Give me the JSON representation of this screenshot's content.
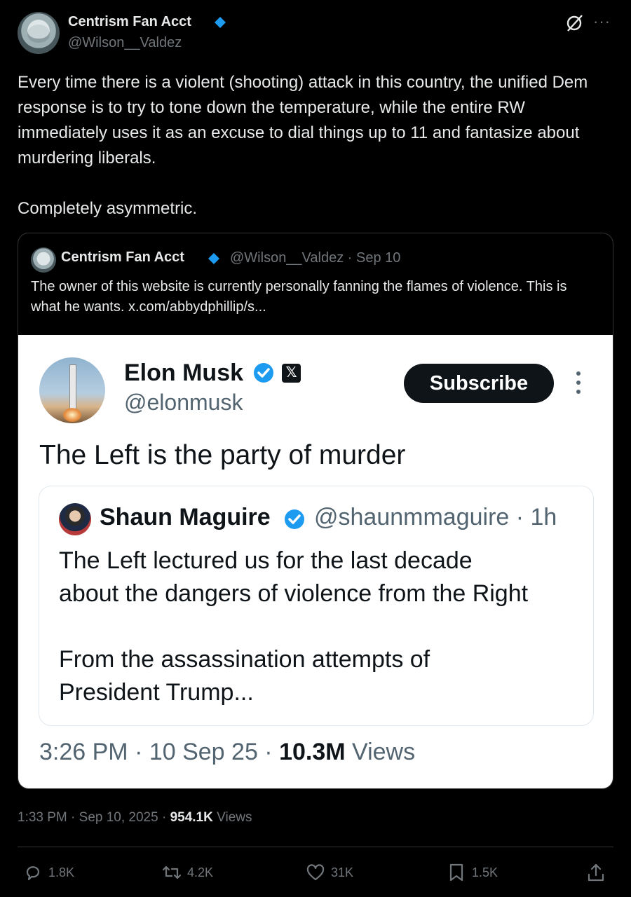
{
  "post": {
    "author_name": "Centrism Fan Acct",
    "author_handle": "@Wilson__Valdez",
    "text": "Every time there is a violent (shooting) attack in this country, the unified Dem response is to try to tone down the temperature, while the entire RW immediately uses it as an excuse to dial things up to 11 and fantasize about murdering liberals.\n\nCompletely asymmetric.",
    "time": "1:33 PM · Sep 10, 2025 · ",
    "views_count": "954.1K",
    "views_label": " Views"
  },
  "quote": {
    "author_name": "Centrism Fan Acct",
    "handle_date": "@Wilson__Valdez · Sep 10",
    "text": "The owner of this website is currently personally fanning the flames of violence. This is what he wants.  x.com/abbydphillip/s..."
  },
  "screenshot": {
    "name": "Elon Musk",
    "handle": "@elonmusk",
    "x_badge": "𝕏",
    "subscribe_label": "Subscribe",
    "text": "The Left is the party of murder",
    "inner_name": "Shaun Maguire",
    "inner_handle": "@shaunmmaguire · 1h",
    "inner_text": "The Left lectured us for the last decade\nabout the dangers of violence from the Right\n\nFrom the assassination attempts of\nPresident Trump...",
    "meta_time": "3:26 PM · 10 Sep 25 · ",
    "meta_views": "10.3M",
    "meta_views_label": " Views"
  },
  "actions": {
    "replies": "1.8K",
    "reposts": "4.2K",
    "likes": "31K",
    "bookmarks": "1.5K"
  },
  "colors": {
    "verified_blue": "#1d9bf0",
    "muted": "#71767b",
    "text": "#e7e9ea"
  }
}
